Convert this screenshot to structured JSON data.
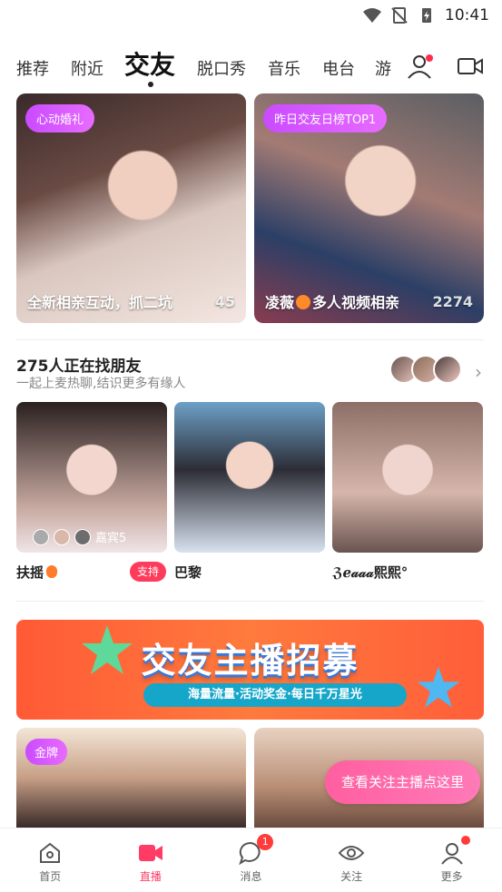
{
  "status_bar": {
    "time": "10:41"
  },
  "tabs": [
    "推荐",
    "附近",
    "交友",
    "脱口秀",
    "音乐",
    "电台",
    "游"
  ],
  "active_tab": "交友",
  "featured": [
    {
      "badge": "心动婚礼",
      "caption": "全新相亲互动，抓二坑",
      "count": "45"
    },
    {
      "badge": "昨日交友日榜TOP1",
      "caption": "凌薇",
      "caption_suffix": "多人视频相亲",
      "count": "2274"
    }
  ],
  "section": {
    "title": "275人正在找朋友",
    "subtitle": "一起上麦热聊,结识更多有缘人"
  },
  "rooms": [
    {
      "name": "扶摇",
      "guest_label": "嘉宾5",
      "support": "支持"
    },
    {
      "name": "巴黎"
    },
    {
      "name": "ℨℯ𝒶𝒶𝒶熙熙°"
    }
  ],
  "banner": {
    "title": "交友主播招募",
    "ribbon": "海量流量·活动奖金·每日千万星光"
  },
  "bottom_cards": [
    {
      "badge": "金牌"
    },
    {
      "badge": ""
    }
  ],
  "follow_pill": "查看关注主播点这里",
  "bottom_nav": [
    {
      "label": "首页",
      "icon": "home-icon"
    },
    {
      "label": "直播",
      "icon": "live-camera-icon",
      "active": true
    },
    {
      "label": "消息",
      "icon": "message-icon",
      "badge": "1"
    },
    {
      "label": "关注",
      "icon": "eye-icon"
    },
    {
      "label": "更多",
      "icon": "person-icon",
      "dot": true
    }
  ],
  "colors": {
    "accent": "#ff3b66",
    "badge_purple": "#c94bff",
    "support_red": "#ff3b5c"
  }
}
